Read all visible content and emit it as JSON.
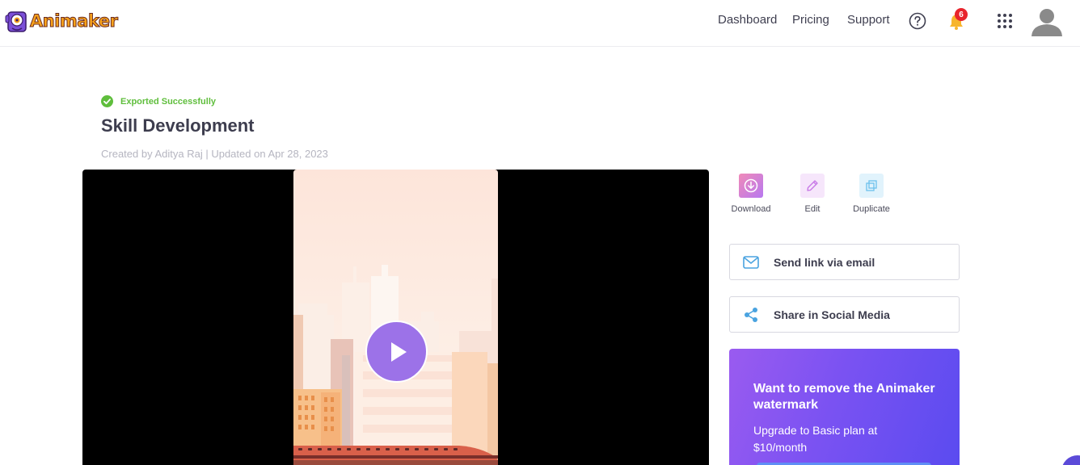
{
  "header": {
    "logo_text": "Animaker",
    "nav": {
      "dashboard": "Dashboard",
      "pricing": "Pricing",
      "support": "Support"
    },
    "notification_count": "6",
    "icons": [
      "help-icon",
      "bell-icon",
      "apps-grid-icon",
      "user-avatar-icon"
    ]
  },
  "project": {
    "status": "Exported Successfully",
    "title": "Skill Development",
    "meta": "Created by Aditya Raj | Updated on Apr 28, 2023"
  },
  "actions": {
    "download": "Download",
    "edit": "Edit",
    "duplicate": "Duplicate"
  },
  "share": {
    "email": "Send link via email",
    "social": "Share in Social Media"
  },
  "promo": {
    "title": "Want to remove the Animaker watermark",
    "subtitle": "Upgrade to Basic plan at $10/month"
  },
  "colors": {
    "accent_purple": "#9c72e8",
    "success_green": "#5fbe3c",
    "badge_red": "#e8242c",
    "share_blue": "#4aa3e0"
  }
}
